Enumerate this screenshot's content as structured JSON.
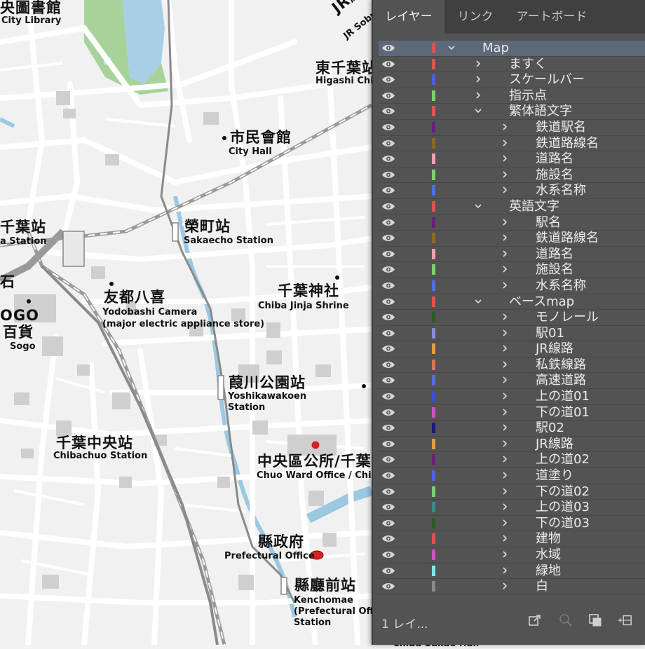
{
  "map": {
    "labels": [
      {
        "id": "city-library-jp",
        "text": "央圖書館",
        "cls": "jp"
      },
      {
        "id": "city-library-en",
        "text": "City Library",
        "cls": "en"
      },
      {
        "id": "jr-sobu-jp",
        "text": "JR總武",
        "cls": "jp"
      },
      {
        "id": "jr-sobu-en",
        "text": "JR Sobu",
        "cls": "en"
      },
      {
        "id": "higashi-chiba-jp",
        "text": "東千葉站",
        "cls": "jp"
      },
      {
        "id": "higashi-chiba-en",
        "text": "Higashi Chib",
        "cls": "en"
      },
      {
        "id": "city-hall-jp",
        "text": "市民會館",
        "cls": "jp"
      },
      {
        "id": "city-hall-en",
        "text": "City Hall",
        "cls": "en"
      },
      {
        "id": "chiba-station-jp",
        "text": "千葉站",
        "cls": "jp"
      },
      {
        "id": "chiba-station-en",
        "text": "a Station",
        "cls": "en"
      },
      {
        "id": "sakaecho-jp",
        "text": "榮町站",
        "cls": "jp"
      },
      {
        "id": "sakaecho-en",
        "text": "Sakaecho Station",
        "cls": "en"
      },
      {
        "id": "yodobashi-jp",
        "text": "友都八喜",
        "cls": "jp"
      },
      {
        "id": "yodobashi-en1",
        "text": "Yodobashi Camera",
        "cls": "en"
      },
      {
        "id": "yodobashi-en2",
        "text": "(major electric appliance store)",
        "cls": "en"
      },
      {
        "id": "chiba-jinja-jp",
        "text": "千葉神社",
        "cls": "jp"
      },
      {
        "id": "chiba-jinja-en",
        "text": "Chiba Jinja Shrine",
        "cls": "en"
      },
      {
        "id": "sogo-a",
        "text": "石",
        "cls": "jp"
      },
      {
        "id": "sogo-b",
        "text": "OGO",
        "cls": "jp"
      },
      {
        "id": "sogo-jp",
        "text": "百貨",
        "cls": "jp"
      },
      {
        "id": "sogo-en",
        "text": "Sogo",
        "cls": "en"
      },
      {
        "id": "yoshikawakoen-jp",
        "text": "葭川公園站",
        "cls": "jp"
      },
      {
        "id": "yoshikawakoen-en1",
        "text": "Yoshikawakoen",
        "cls": "en"
      },
      {
        "id": "yoshikawakoen-en2",
        "text": "Station",
        "cls": "en"
      },
      {
        "id": "chibachuo-jp",
        "text": "千葉中央站",
        "cls": "jp"
      },
      {
        "id": "chibachuo-en",
        "text": "Chibachuo Station",
        "cls": "en"
      },
      {
        "id": "chuo-ward-jp",
        "text": "中央區公所/千葉",
        "cls": "jp"
      },
      {
        "id": "chuo-ward-en",
        "text": "Chuo Ward Office / Chiba",
        "cls": "en"
      },
      {
        "id": "prefectural-jp",
        "text": "縣政府",
        "cls": "jp"
      },
      {
        "id": "prefectural-en",
        "text": "Prefectural Office",
        "cls": "en"
      },
      {
        "id": "kenchomae-jp",
        "text": "縣廳前站",
        "cls": "jp"
      },
      {
        "id": "kenchomae-en1",
        "text": "Kenchomae",
        "cls": "en"
      },
      {
        "id": "kenchomae-en2",
        "text": "(Prefectural Offi",
        "cls": "en"
      },
      {
        "id": "kenchomae-en3",
        "text": "Station",
        "cls": "en"
      },
      {
        "id": "chiba-sakae-fragment",
        "text": "Chiba Sakae Hall",
        "cls": "en"
      }
    ]
  },
  "panel": {
    "tabs": [
      "レイヤー",
      "リンク",
      "アートボード"
    ],
    "active_tab": 0,
    "layers": [
      {
        "name": "Map",
        "color": "#e35151",
        "level": 0,
        "expanded": true,
        "selected": true
      },
      {
        "name": "ますく",
        "color": "#e35151",
        "level": 1,
        "expanded": false
      },
      {
        "name": "スケールバー",
        "color": "#4f5fe6",
        "level": 1,
        "expanded": false
      },
      {
        "name": "指示点",
        "color": "#7ad26a",
        "level": 1,
        "expanded": false
      },
      {
        "name": "繁体語文字",
        "color": "#e35151",
        "level": 1,
        "expanded": true
      },
      {
        "name": "鉄道駅名",
        "color": "#6a1f7a",
        "level": 2,
        "expanded": false
      },
      {
        "name": "鉄道路線名",
        "color": "#8a6a1e",
        "level": 2,
        "expanded": false
      },
      {
        "name": "道路名",
        "color": "#f0a0a8",
        "level": 2,
        "expanded": false
      },
      {
        "name": "施設名",
        "color": "#7ad26a",
        "level": 2,
        "expanded": false
      },
      {
        "name": "水系名称",
        "color": "#4f6fe6",
        "level": 2,
        "expanded": false
      },
      {
        "name": "英語文字",
        "color": "#e35151",
        "level": 1,
        "expanded": true
      },
      {
        "name": "駅名",
        "color": "#6a1f7a",
        "level": 2,
        "expanded": false
      },
      {
        "name": "鉄道路線名",
        "color": "#8a6a1e",
        "level": 2,
        "expanded": false
      },
      {
        "name": "道路名",
        "color": "#f0a0a8",
        "level": 2,
        "expanded": false
      },
      {
        "name": "施設名",
        "color": "#7ad26a",
        "level": 2,
        "expanded": false
      },
      {
        "name": "水系名称",
        "color": "#4f6fe6",
        "level": 2,
        "expanded": false
      },
      {
        "name": "ベースmap",
        "color": "#e35151",
        "level": 1,
        "expanded": true
      },
      {
        "name": "モノレール",
        "color": "#2a5e1e",
        "level": 2,
        "expanded": false
      },
      {
        "name": "駅01",
        "color": "#8a8ae0",
        "level": 2,
        "expanded": false
      },
      {
        "name": "JR線路",
        "color": "#e89a3a",
        "level": 2,
        "expanded": false
      },
      {
        "name": "私鉄線路",
        "color": "#e07050",
        "level": 2,
        "expanded": false
      },
      {
        "name": "高速道路",
        "color": "#4f6fe6",
        "level": 2,
        "expanded": false
      },
      {
        "name": "上の道01",
        "color": "#3a50d6",
        "level": 2,
        "expanded": false
      },
      {
        "name": "下の道01",
        "color": "#d050c0",
        "level": 2,
        "expanded": false
      },
      {
        "name": "駅02",
        "color": "#1a1a7a",
        "level": 2,
        "expanded": false
      },
      {
        "name": "JR線路",
        "color": "#e89a3a",
        "level": 2,
        "expanded": false
      },
      {
        "name": "上の道02",
        "color": "#6a1f7a",
        "level": 2,
        "expanded": false
      },
      {
        "name": "道塗り",
        "color": "#4f5fe6",
        "level": 2,
        "expanded": false
      },
      {
        "name": "下の道02",
        "color": "#7ad26a",
        "level": 2,
        "expanded": false
      },
      {
        "name": "上の道03",
        "color": "#3a8a8a",
        "level": 2,
        "expanded": false
      },
      {
        "name": "下の道03",
        "color": "#2a5e1e",
        "level": 2,
        "expanded": false
      },
      {
        "name": "建物",
        "color": "#e35151",
        "level": 2,
        "expanded": false
      },
      {
        "name": "水域",
        "color": "#d050c0",
        "level": 2,
        "expanded": false
      },
      {
        "name": "緑地",
        "color": "#7ae8e8",
        "level": 2,
        "expanded": false
      },
      {
        "name": "白",
        "color": "#8a8a8a",
        "level": 2,
        "expanded": false
      }
    ],
    "footer": {
      "count_label": "1 レイ..."
    }
  }
}
